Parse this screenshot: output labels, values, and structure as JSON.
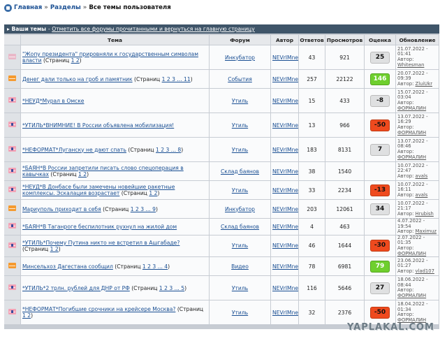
{
  "breadcrumb": {
    "home": "Главная",
    "sections": "Разделы",
    "current": "Все темы пользователя",
    "separator": "»"
  },
  "panel": {
    "lead": "Ваши темы",
    "dash": " - ",
    "link": "Отметить все форумы прочитанными и вернуться на главную страницу"
  },
  "columns": [
    "Тема",
    "Форум",
    "Автор",
    "Ответов",
    "Просмотров",
    "Оценка",
    "Обновление"
  ],
  "rows": [
    {
      "icon": "read-envelope-icon",
      "title": "\"Жопу президента\" прировняли к государственным символам власти",
      "pages": " (Страниц ",
      "page_links": "1 2",
      "close": ")",
      "forum": "Инкубатор",
      "author": "NEVrIMne",
      "replies": "43",
      "views": "921",
      "score": "25",
      "score_kind": "pos",
      "date": "21.07.2022 - 01:41",
      "updater_label": "Автор: ",
      "updater": "Whitesman"
    },
    {
      "icon": "hot-envelope-icon",
      "title": "Денег дали только на гроб и памятник",
      "pages": " (Страниц ",
      "page_links": "1 2 3 ... 11",
      "close": ")",
      "forum": "События",
      "author": "NEVrIMne",
      "replies": "257",
      "views": "22122",
      "score": "146",
      "score_kind": "grn",
      "date": "20.07.2022 - 09:39",
      "updater_label": "Автор: ",
      "updater": "ZluiUkr"
    },
    {
      "icon": "pinned-envelope-icon",
      "title": "*НЕУД*Мурал в Омске",
      "pages": "",
      "page_links": "",
      "close": "",
      "forum": "Утиль",
      "author": "NEVrIMne",
      "replies": "15",
      "views": "433",
      "score": "-8",
      "score_kind": "pos",
      "date": "15.07.2022 - 03:04",
      "updater_label": "Автор: ",
      "updater": "ФОРМАЛИН"
    },
    {
      "icon": "pinned-envelope-icon",
      "title": "*УТИЛЬ*ВНИМНИЕ! В России объявлена мобилизация!",
      "pages": "",
      "page_links": "",
      "close": "",
      "forum": "Утиль",
      "author": "NEVrIMne",
      "replies": "13",
      "views": "966",
      "score": "-50",
      "score_kind": "neg",
      "date": "13.07.2022 - 16:29",
      "updater_label": "Автор: ",
      "updater": "ФОРМАЛИН"
    },
    {
      "icon": "pinned-envelope-icon",
      "title": "*НЕФОРМАТ*Луганску не дают спать",
      "pages": " (Страниц ",
      "page_links": "1 2 3 ... 8",
      "close": ")",
      "forum": "Утиль",
      "author": "NEVrIMne",
      "replies": "183",
      "views": "8131",
      "score": "7",
      "score_kind": "pos",
      "date": "13.07.2022 - 08:46",
      "updater_label": "Автор: ",
      "updater": "ФОРМАЛИН"
    },
    {
      "icon": "pinned-envelope-icon",
      "title": "*БАЯН*В России запретили писать слово спецоперация в кавычках",
      "pages": " (Страниц ",
      "page_links": "1 2",
      "close": ")",
      "forum": "Склад баянов",
      "author": "NEVrIMne",
      "replies": "38",
      "views": "1540",
      "score": "",
      "score_kind": "none",
      "date": "10.07.2022 - 22:47",
      "updater_label": "Автор: ",
      "updater": "avals"
    },
    {
      "icon": "pinned-envelope-icon",
      "title": "*НЕУД*В Донбасе были замечены новейшие ракетные комплексы. Эскалация возрастает",
      "pages": " (Страниц ",
      "page_links": "1 2",
      "close": ")",
      "forum": "Утиль",
      "author": "NEVrIMne",
      "replies": "33",
      "views": "2234",
      "score": "-13",
      "score_kind": "neg",
      "date": "10.07.2022 - 16:11",
      "updater_label": "Автор: ",
      "updater": "avals"
    },
    {
      "icon": "hot-envelope-icon",
      "title": "Мариуполь приходит в себя",
      "pages": " (Страниц ",
      "page_links": "1 2 3 ... 9",
      "close": ")",
      "forum": "Инкубатор",
      "author": "NEVrIMne",
      "replies": "203",
      "views": "12061",
      "score": "34",
      "score_kind": "pos",
      "date": "10.07.2022 - 21:17",
      "updater_label": "Автор: ",
      "updater": "Hrubish"
    },
    {
      "icon": "pinned-envelope-icon",
      "title": "*БАЯН*В Таганроге беспилотник рухнул на жилой дом",
      "pages": "",
      "page_links": "",
      "close": "",
      "forum": "Склад баянов",
      "author": "NEVrIMne",
      "replies": "4",
      "views": "463",
      "score": "",
      "score_kind": "none",
      "date": "4.07.2022 - 19:54",
      "updater_label": "Автор: ",
      "updater": "Maximuz"
    },
    {
      "icon": "pinned-envelope-icon",
      "title": "*УТИЛЬ*Почему Путина никто не встретил в Ашгабаде?",
      "pages": " (Страниц ",
      "page_links": "1 2",
      "close": ")",
      "forum": "Утиль",
      "author": "NEVrIMne",
      "replies": "46",
      "views": "1644",
      "score": "-30",
      "score_kind": "neg",
      "date": "2.07.2022 - 01:35",
      "updater_label": "Автор: ",
      "updater": "ФОРМАЛИН"
    },
    {
      "icon": "hot-envelope-icon",
      "title": "Минсельхоз Дагестана сообщил",
      "pages": " (Страниц ",
      "page_links": "1 2 3 ... 4",
      "close": ")",
      "forum": "Видео",
      "author": "NEVrIMne",
      "replies": "78",
      "views": "6981",
      "score": "79",
      "score_kind": "grn",
      "date": "23.06.2022 - 01:27",
      "updater_label": "Автор: ",
      "updater": "vlad107"
    },
    {
      "icon": "pinned-envelope-icon",
      "title": "*УТИЛЬ*2 трлн. рублей для ДНР от РФ",
      "pages": " (Страниц ",
      "page_links": "1 2 3 ... 5",
      "close": ")",
      "forum": "Утиль",
      "author": "NEVrIMne",
      "replies": "116",
      "views": "5646",
      "score": "27",
      "score_kind": "pos",
      "date": "18.06.2022 - 08:44",
      "updater_label": "Автор: ",
      "updater": "ФОРМАЛИН"
    },
    {
      "icon": "pinned-envelope-icon",
      "title": "*НЕФОРМАТ*Погибшие срочники на крейсере Москва?",
      "pages": " (Страниц ",
      "page_links": "1 2",
      "close": ")",
      "forum": "Утиль",
      "author": "NEVrIMne",
      "replies": "32",
      "views": "2376",
      "score": "-50",
      "score_kind": "neg",
      "date": "18.04.2022 - 01:34",
      "updater_label": "Автор: ",
      "updater": "ФОРМАЛИН"
    }
  ],
  "watermark": "YAPLAKAL.COM"
}
